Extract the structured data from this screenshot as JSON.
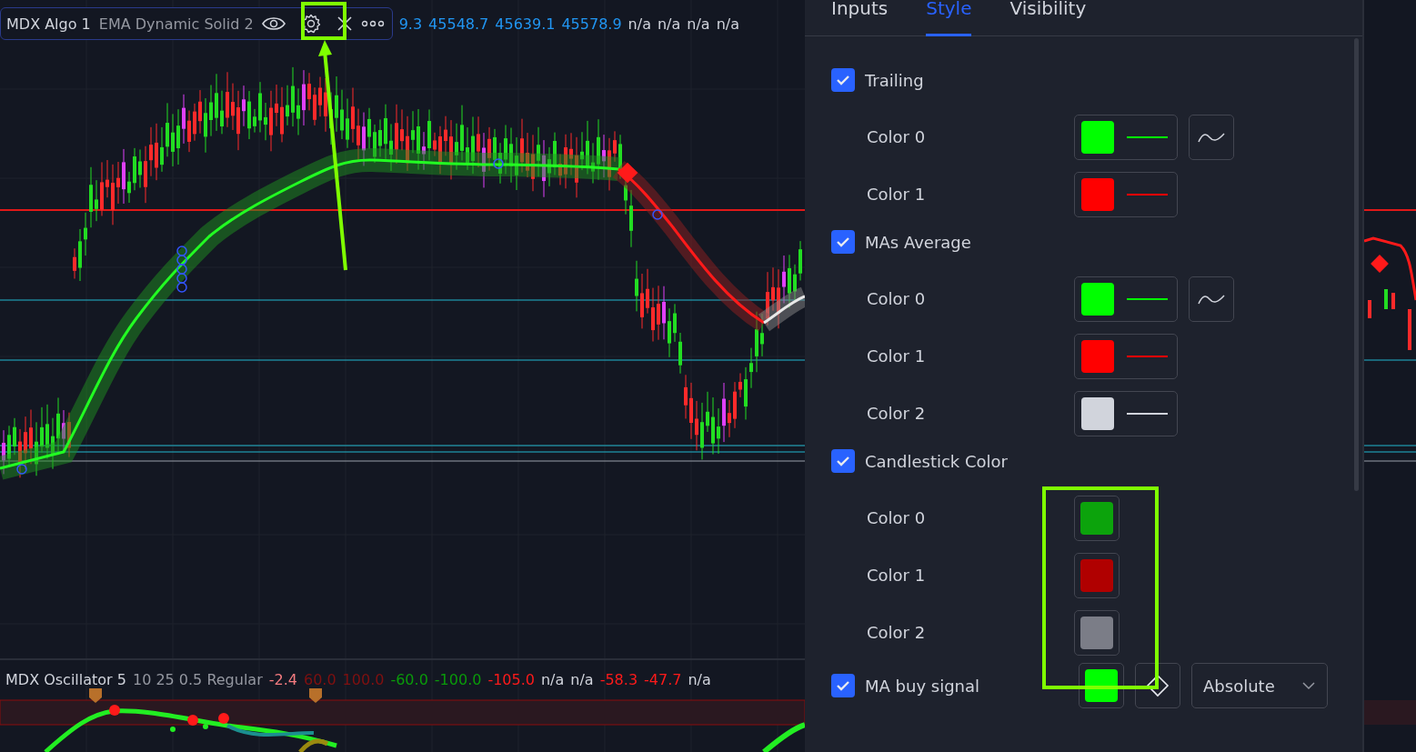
{
  "chart": {
    "legend": {
      "title": "MDX Algo 1",
      "params": "EMA Dynamic Solid 2",
      "values": [
        {
          "text": "9.3",
          "color": "#2196f3"
        },
        {
          "text": "45548.7",
          "color": "#2196f3"
        },
        {
          "text": "45639.1",
          "color": "#2196f3"
        },
        {
          "text": "45578.9",
          "color": "#2196f3"
        },
        {
          "text": "n/a",
          "color": "#d1d4dc"
        },
        {
          "text": "n/a",
          "color": "#d1d4dc"
        },
        {
          "text": "n/a",
          "color": "#d1d4dc"
        },
        {
          "text": "n/a",
          "color": "#d1d4dc"
        }
      ]
    }
  },
  "oscillator": {
    "legend": {
      "title": "MDX Oscillator 5",
      "params": "10 25 0.5 Regular",
      "values": [
        {
          "text": "-2.4",
          "color": "#f77c80"
        },
        {
          "text": "60.0",
          "color": "#801010"
        },
        {
          "text": "100.0",
          "color": "#801010"
        },
        {
          "text": "-60.0",
          "color": "#0a9a0a"
        },
        {
          "text": "-100.0",
          "color": "#0a9a0a"
        },
        {
          "text": "-105.0",
          "color": "#ff1a1a"
        },
        {
          "text": "n/a",
          "color": "#d1d4dc"
        },
        {
          "text": "n/a",
          "color": "#d1d4dc"
        },
        {
          "text": "-58.3",
          "color": "#ff1a1a"
        },
        {
          "text": "-47.7",
          "color": "#ff1a1a"
        },
        {
          "text": "n/a",
          "color": "#d1d4dc"
        }
      ]
    }
  },
  "settings": {
    "tabs": [
      {
        "label": "Inputs",
        "selected": false
      },
      {
        "label": "Style",
        "selected": true
      },
      {
        "label": "Visibility",
        "selected": false
      }
    ],
    "groups": [
      {
        "kind": "section",
        "label": "Trailing",
        "checked": true,
        "rows": [
          {
            "label": "Color 0",
            "kind": "color-line",
            "color": "#00ff00",
            "style_button": true
          },
          {
            "label": "Color 1",
            "kind": "color-line",
            "color": "#ff0000",
            "style_button": false
          }
        ]
      },
      {
        "kind": "section",
        "label": "MAs Average",
        "checked": true,
        "rows": [
          {
            "label": "Color 0",
            "kind": "color-line",
            "color": "#00ff00",
            "style_button": true
          },
          {
            "label": "Color 1",
            "kind": "color-line",
            "color": "#ff0000",
            "style_button": false
          },
          {
            "label": "Color 2",
            "kind": "color-line",
            "color": "#d1d4dc",
            "style_button": false
          }
        ]
      },
      {
        "kind": "section",
        "label": "Candlestick Color",
        "checked": true,
        "rows": [
          {
            "label": "Color 0",
            "kind": "swatch",
            "color": "#0ca30c",
            "style_button": false
          },
          {
            "label": "Color 1",
            "kind": "swatch",
            "color": "#b00000",
            "style_button": false
          },
          {
            "label": "Color 2",
            "kind": "swatch",
            "color": "#7b7d87",
            "style_button": false
          }
        ]
      },
      {
        "kind": "inline",
        "label": "MA buy signal",
        "checked": true,
        "color": "#00ff00",
        "shape_button": true,
        "dropdown": "Absolute"
      }
    ]
  }
}
